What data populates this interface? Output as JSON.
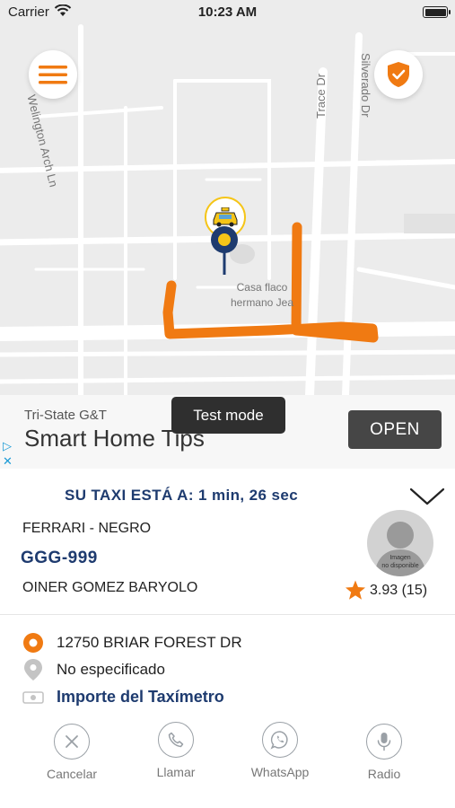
{
  "status_bar": {
    "carrier": "Carrier",
    "time": "10:23 AM"
  },
  "map": {
    "streets": [
      "Welington Arch Ln",
      "Trace Dr",
      "Silverado Dr"
    ],
    "poi": {
      "line1": "Casa flaco",
      "line2": "hermano Jea"
    },
    "route_color": "#f07a12"
  },
  "ad": {
    "test_badge": "Test mode",
    "sponsor": "Tri-State G&T",
    "headline": "Smart Home Tips",
    "open_label": "OPEN"
  },
  "trip": {
    "eta_text": "SU TAXI ESTÁ A: 1 min, 26 sec",
    "vehicle": "FERRARI - NEGRO",
    "plate": "GGG-999",
    "driver_name": "OINER GOMEZ BARYOLO",
    "rating": "3.93 (15)",
    "avatar_caption_1": "Imagen",
    "avatar_caption_2": "no disponible",
    "origin": "12750 BRIAR FOREST DR",
    "destination": "No especificado",
    "fare_label": "Importe del Taxímetro"
  },
  "actions": {
    "cancel": "Cancelar",
    "call": "Llamar",
    "whatsapp": "WhatsApp",
    "radio": "Radio"
  },
  "colors": {
    "accent": "#f07a12",
    "brand_blue": "#1e3b6f",
    "taxi_yellow": "#f5c518"
  }
}
